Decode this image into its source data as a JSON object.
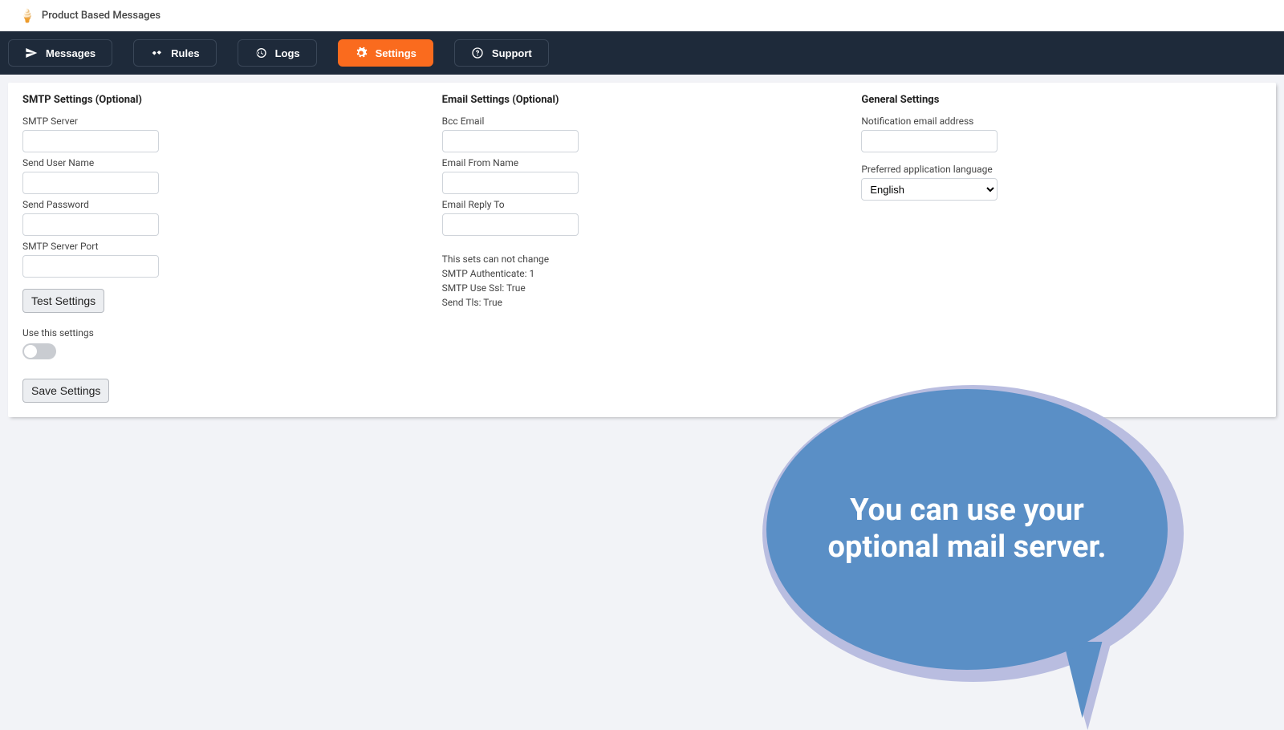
{
  "header": {
    "title": "Product Based Messages"
  },
  "nav": {
    "messages": "Messages",
    "rules": "Rules",
    "logs": "Logs",
    "settings": "Settings",
    "support": "Support"
  },
  "smtp": {
    "title": "SMTP Settings (Optional)",
    "server_label": "SMTP Server",
    "server_value": "",
    "user_label": "Send User Name",
    "user_value": "",
    "pass_label": "Send Password",
    "pass_value": "",
    "port_label": "SMTP Server Port",
    "port_value": "",
    "test_btn": "Test Settings",
    "use_label": "Use this settings",
    "save_btn": "Save Settings"
  },
  "email": {
    "title": "Email Settings (Optional)",
    "bcc_label": "Bcc Email",
    "bcc_value": "",
    "from_label": "Email From Name",
    "from_value": "",
    "reply_label": "Email Reply To",
    "reply_value": "",
    "info_line1": "This sets can not change",
    "info_line2": "SMTP Authenticate: 1",
    "info_line3": "SMTP Use Ssl: True",
    "info_line4": "Send Tls: True"
  },
  "general": {
    "title": "General Settings",
    "notif_label": "Notification email address",
    "notif_value": "",
    "lang_label": "Preferred application language",
    "lang_value": "English"
  },
  "callout": {
    "text": "You can use your optional mail server."
  }
}
